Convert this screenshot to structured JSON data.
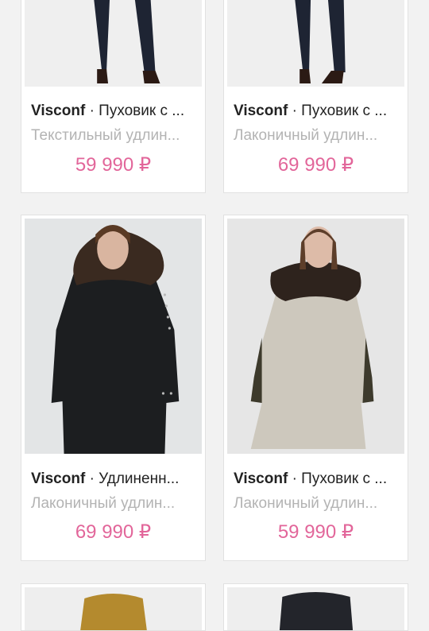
{
  "products": [
    {
      "brand": "Visconf",
      "separator": "·",
      "name": "Пуховик с ...",
      "description": "Текстильный удлин...",
      "price": "59 990 ₽",
      "image": "woman-dark-jeans-legs"
    },
    {
      "brand": "Visconf",
      "separator": "·",
      "name": "Пуховик с ...",
      "description": "Лаконичный удлин...",
      "price": "69 990 ₽",
      "image": "woman-dark-jeans-legs"
    },
    {
      "brand": "Visconf",
      "separator": "·",
      "name": "Удлиненн...",
      "description": "Лаконичный удлин...",
      "price": "69 990 ₽",
      "image": "woman-black-parka-fur-hood"
    },
    {
      "brand": "Visconf",
      "separator": "·",
      "name": "Пуховик с ...",
      "description": "Лаконичный удлин...",
      "price": "59 990 ₽",
      "image": "woman-beige-parka-fur-collar"
    },
    {
      "image": "mustard-coat-collar"
    },
    {
      "image": "dark-coat-collar"
    }
  ],
  "colors": {
    "price": "#e2669a",
    "background": "#f2f2f2",
    "card": "#ffffff"
  }
}
